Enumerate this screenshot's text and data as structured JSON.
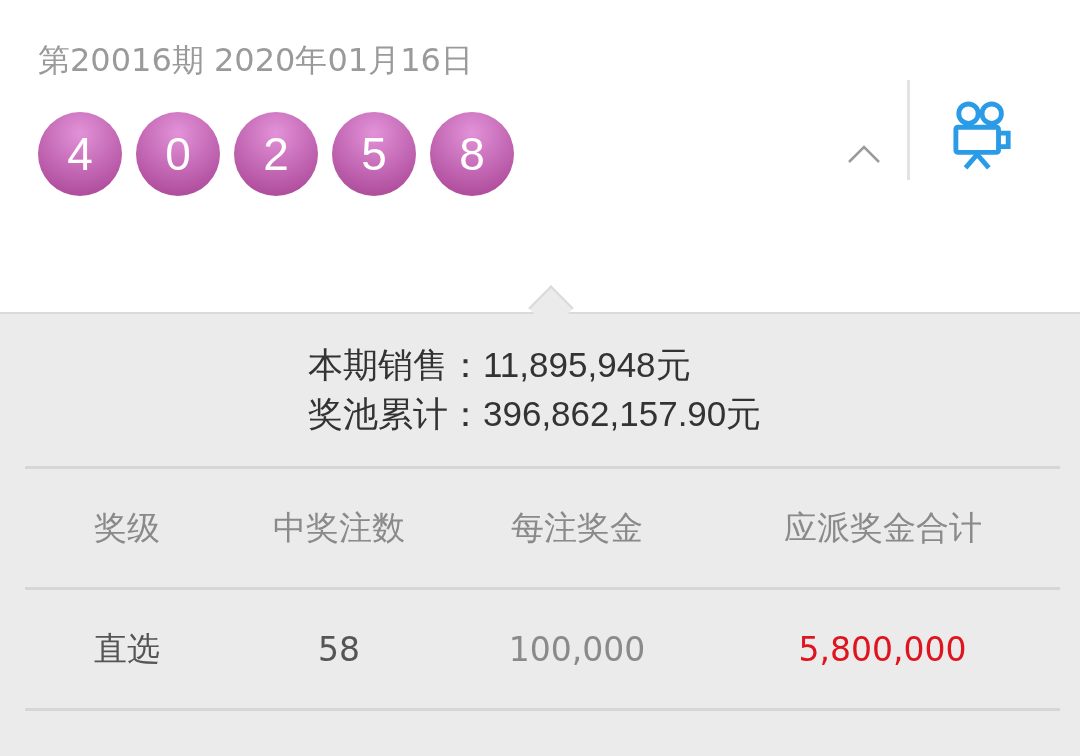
{
  "draw": {
    "issue": "第20016期 2020年01月16日",
    "balls": [
      "4",
      "0",
      "2",
      "5",
      "8"
    ],
    "expanded": true
  },
  "summary": [
    "本期销售：11,895,948元",
    "奖池累计：396,862,157.90元"
  ],
  "table": {
    "columns": [
      "奖级",
      "中奖注数",
      "每注奖金",
      "应派奖金合计"
    ],
    "rows": [
      [
        {
          "kind": "label",
          "text": "直选"
        },
        {
          "kind": "count",
          "text": "58"
        },
        {
          "kind": "amount",
          "text": "100,000"
        },
        {
          "kind": "total",
          "text": "5,800,000"
        }
      ]
    ]
  }
}
